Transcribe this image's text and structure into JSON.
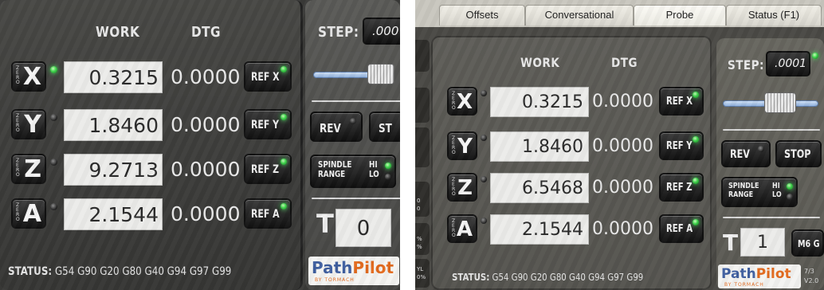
{
  "left": {
    "headers": {
      "work": "WORK",
      "dtg": "DTG"
    },
    "axes": [
      {
        "letter": "X",
        "zero_label": "ZERO",
        "work": "0.3215",
        "dtg": "0.0000",
        "ref_label": "REF X",
        "axis_led": "on",
        "ref_led": "on"
      },
      {
        "letter": "Y",
        "zero_label": "ZERO",
        "work": "1.8460",
        "dtg": "0.0000",
        "ref_label": "REF Y",
        "axis_led": "off",
        "ref_led": "on"
      },
      {
        "letter": "Z",
        "zero_label": "ZERO",
        "work": "9.2713",
        "dtg": "0.0000",
        "ref_label": "REF Z",
        "axis_led": "off",
        "ref_led": "on"
      },
      {
        "letter": "A",
        "zero_label": "ZERO",
        "work": "2.1544",
        "dtg": "0.0000",
        "ref_label": "REF A",
        "axis_led": "off",
        "ref_led": "on"
      }
    ],
    "status_label": "STATUS:",
    "status_codes": "G54 G90 G20 G80 G40 G94 G97 G99",
    "side": {
      "step_label": "STEP:",
      "step_value": ".000",
      "rev_label": "REV",
      "stop_label": "ST",
      "spindle_label_1": "SPINDLE",
      "spindle_label_2": "RANGE",
      "hi_label": "HI",
      "lo_label": "LO",
      "tool_label": "T",
      "tool_value": "0",
      "logo_path": "Path",
      "logo_pilot": "Pilot",
      "logo_sub": "BY TORMACH"
    }
  },
  "right": {
    "tabs": [
      "Offsets",
      "Conversational",
      "Probe",
      "Status (F1)"
    ],
    "headers": {
      "work": "WORK",
      "dtg": "DTG"
    },
    "axes": [
      {
        "letter": "X",
        "zero_label": "ZERO",
        "work": "0.3215",
        "dtg": "0.0000",
        "ref_label": "REF X",
        "axis_led": "off",
        "ref_led": "on"
      },
      {
        "letter": "Y",
        "zero_label": "ZERO",
        "work": "1.8460",
        "dtg": "0.0000",
        "ref_label": "REF Y",
        "axis_led": "off",
        "ref_led": "on"
      },
      {
        "letter": "Z",
        "zero_label": "ZERO",
        "work": "6.5468",
        "dtg": "0.0000",
        "ref_label": "REF Z",
        "axis_led": "off",
        "ref_led": "on"
      },
      {
        "letter": "A",
        "zero_label": "ZERO",
        "work": "2.1544",
        "dtg": "0.0000",
        "ref_label": "REF A",
        "axis_led": "off",
        "ref_led": "on"
      }
    ],
    "status_label": "STATUS:",
    "status_codes": "G54 G90 G20 G80 G40 G94 G97 G99",
    "side": {
      "step_label": "STEP:",
      "step_value": ".0001",
      "rev_label": "REV",
      "stop_label": "STOP",
      "spindle_label_1": "SPINDLE",
      "spindle_label_2": "RANGE",
      "hi_label": "HI",
      "lo_label": "LO",
      "tool_label": "T",
      "tool_value": "1",
      "m6_label": "M6 G",
      "logo_path": "Path",
      "logo_pilot": "Pilot",
      "logo_sub": "BY TORMACH",
      "version_top": "7/3",
      "version_bottom": "V2.0"
    },
    "edge_text": [
      "0",
      "0",
      "%",
      "%",
      "YL",
      "0%"
    ]
  }
}
